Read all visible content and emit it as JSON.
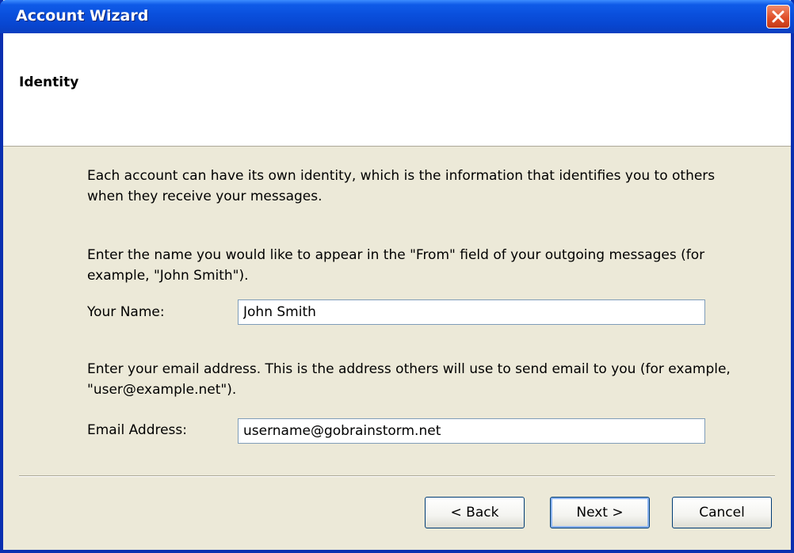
{
  "window": {
    "title": "Account Wizard",
    "close_icon": "close-icon"
  },
  "header": {
    "title": "Identity"
  },
  "content": {
    "intro": "Each account can have its own identity, which is the information that identifies you to others when they receive your messages.",
    "name_instructions": "Enter the name you would like to appear in the \"From\" field of your outgoing messages (for example, \"John Smith\").",
    "name_label": "Your Name:",
    "name_value": "John Smith",
    "email_instructions": "Enter your email address. This is the address others will use to send email to you (for example, \"user@example.net\").",
    "email_label": "Email Address:",
    "email_value": "username@gobrainstorm.net"
  },
  "buttons": {
    "back": "< Back",
    "next": "Next >",
    "cancel": "Cancel"
  },
  "colors": {
    "titlebar": "#0a4fdc",
    "dialog_bg": "#ece9d8",
    "close_button": "#e0502a"
  }
}
